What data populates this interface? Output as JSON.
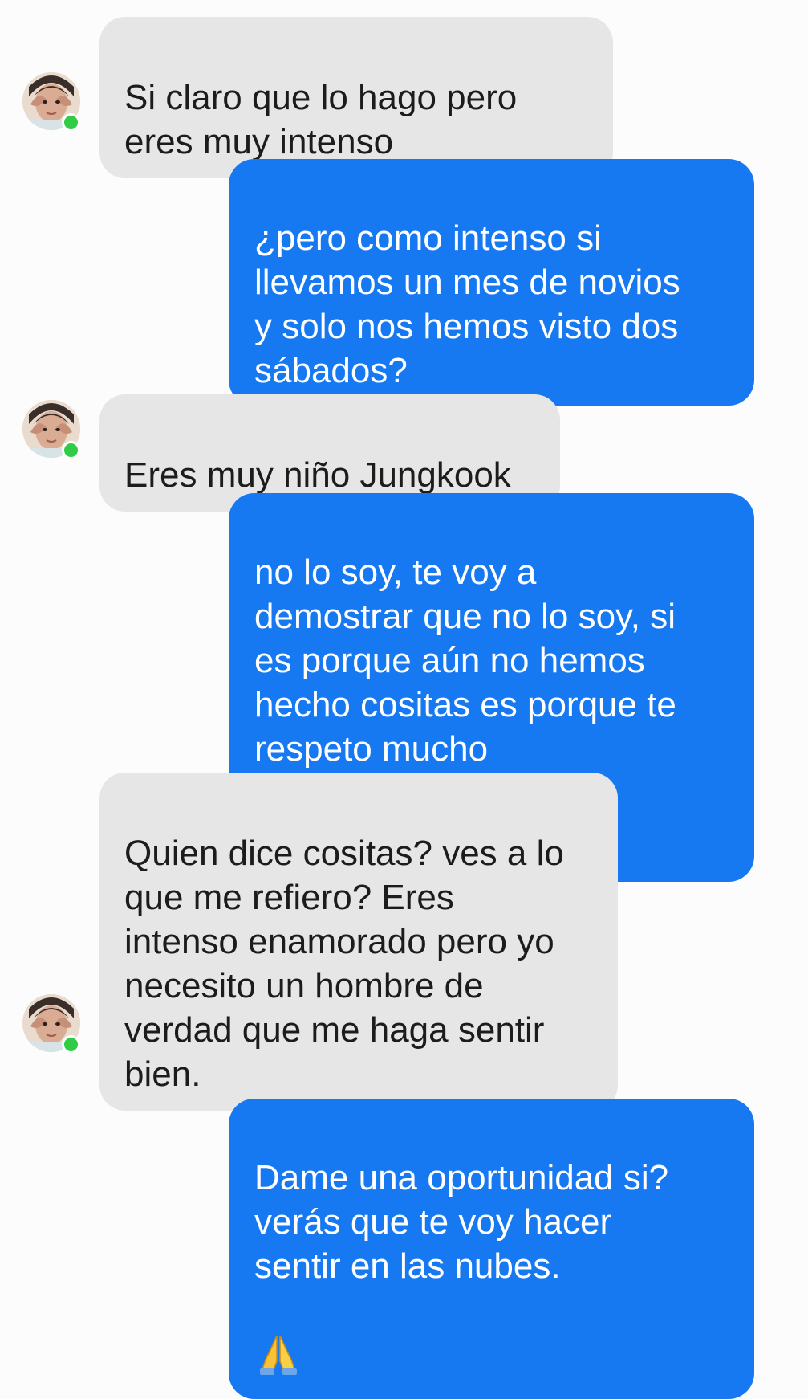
{
  "conversation": {
    "messages": [
      {
        "direction": "received",
        "text": "Si claro que lo hago pero\neres muy intenso"
      },
      {
        "direction": "sent",
        "text": "¿pero como intenso si\nllevamos un mes de novios\ny solo nos hemos visto dos\nsábados?"
      },
      {
        "direction": "received",
        "text": "Eres muy niño Jungkook"
      },
      {
        "direction": "sent",
        "text": "no lo soy, te voy a\ndemostrar que no lo soy, si\nes porque  aún no hemos\nhecho cositas es porque te\nrespeto mucho"
      },
      {
        "direction": "received",
        "text": "Quien dice cositas? ves a lo\nque me refiero? Eres\nintenso enamorado pero yo\nnecesito un hombre de\nverdad que me haga sentir\nbien."
      },
      {
        "direction": "sent",
        "text": "Dame una oportunidad si?\nverás que te voy hacer\nsentir en las nubes."
      }
    ],
    "emojis": {
      "smiling_face": "smiling-face-emoji",
      "folded_hands": "folded-hands-emoji"
    }
  },
  "colors": {
    "background": "#fcfcfc",
    "received_bubble": "#e6e6e6",
    "sent_bubble": "#1779f2",
    "online_indicator": "#31cc46"
  }
}
